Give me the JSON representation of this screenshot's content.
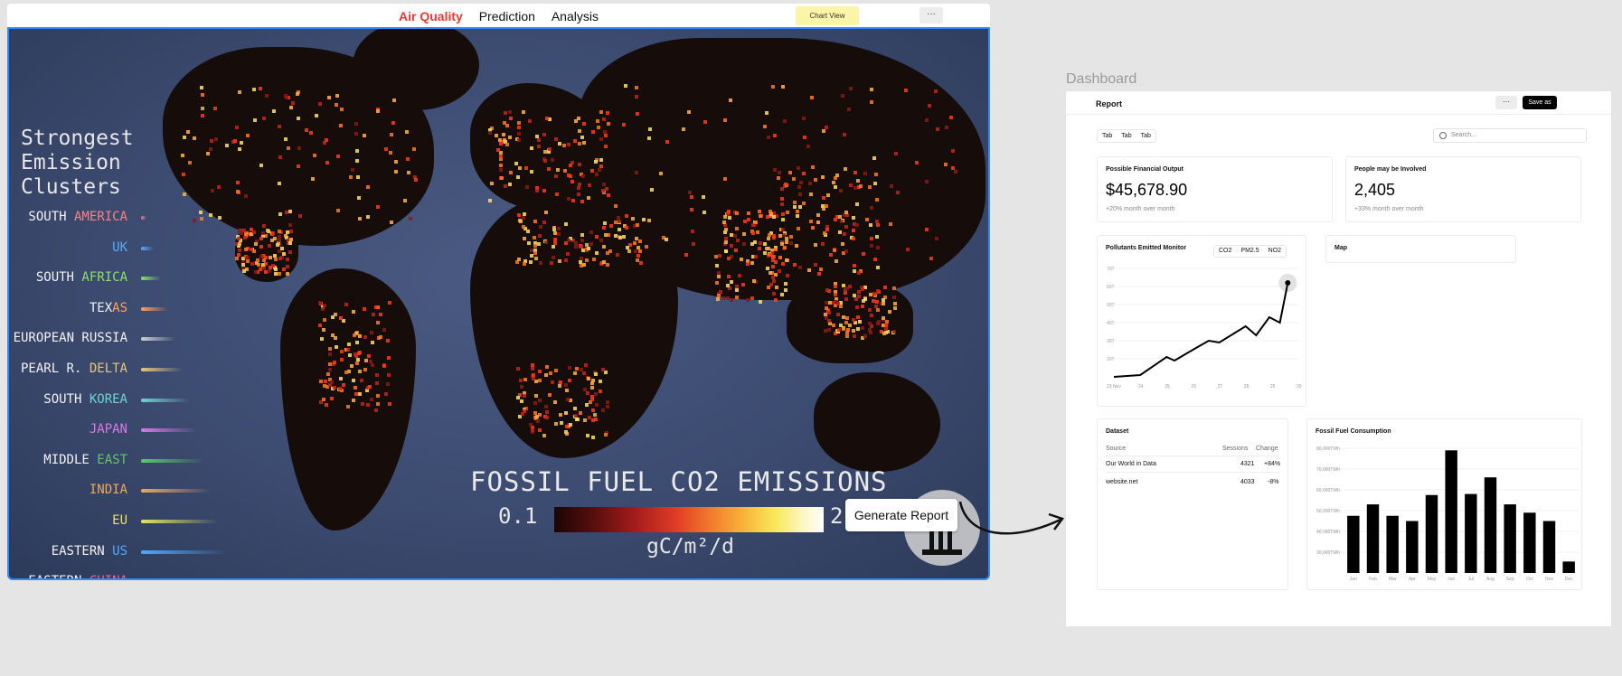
{
  "nav": {
    "items": [
      {
        "label": "Air Quality",
        "active": true
      },
      {
        "label": "Prediction",
        "active": false
      },
      {
        "label": "Analysis",
        "active": false
      }
    ],
    "chart_view_label": "Chart View",
    "more_label": "···"
  },
  "map": {
    "legend_title": "Strongest\nEmission\nClusters",
    "clusters": [
      {
        "pre": "SOUTH ",
        "hl": "AMERICA",
        "color": "#ff8080"
      },
      {
        "pre": "",
        "hl": "UK",
        "color": "#5aa9ff"
      },
      {
        "pre": "SOUTH ",
        "hl": "AFRICA",
        "color": "#8ee06a"
      },
      {
        "pre": "TEX",
        "hl": "AS",
        "color": "#ff9f5a"
      },
      {
        "pre": "EUROPEAN RUSSIA",
        "hl": "",
        "color": "#d0d0d0"
      },
      {
        "pre": "PEARL R. ",
        "hl": "DELTA",
        "color": "#e6c77a"
      },
      {
        "pre": "SOUTH ",
        "hl": "KOREA",
        "color": "#6fd3d3"
      },
      {
        "pre": "",
        "hl": "JAPAN",
        "color": "#d67ae6"
      },
      {
        "pre": "MIDDLE ",
        "hl": "EAST",
        "color": "#5fc96a"
      },
      {
        "pre": "",
        "hl": "INDIA",
        "color": "#f0a85a"
      },
      {
        "pre": "",
        "hl": "EU",
        "color": "#e8e35a"
      },
      {
        "pre": "EASTERN ",
        "hl": "US",
        "color": "#4fa8ff"
      },
      {
        "pre": "EASTERN ",
        "hl": "CHINA",
        "color": "#ff5a8c"
      }
    ],
    "title": "FOSSIL FUEL CO2 EMISSIONS",
    "scale_min": "0.1",
    "scale_max": "2",
    "unit": "gC/m²/d",
    "generate_label": "Generate Report"
  },
  "dashboard": {
    "label": "Dashboard",
    "title": "Report",
    "more_label": "···",
    "save_label": "Save as",
    "tabs": [
      "Tab",
      "Tab",
      "Tab"
    ],
    "search_placeholder": "Search...",
    "kpi": [
      {
        "title": "Possible Financial Output",
        "value": "$45,678.90",
        "sub": "+20% month over month"
      },
      {
        "title": "People may be Involved",
        "value": "2,405",
        "sub": "+33% month over month"
      }
    ],
    "pollutant": {
      "title": "Pollutants Emitted Monitor",
      "tabs": [
        "CO2",
        "PM2.5",
        "NO2"
      ]
    },
    "map_card_title": "Map",
    "dataset": {
      "title": "Dataset",
      "headers": [
        "Source",
        "Sessions",
        "Change"
      ],
      "rows": [
        [
          "Our World in Data",
          "4321",
          "+84%"
        ],
        [
          "website.net",
          "4033",
          "-8%"
        ]
      ]
    },
    "fossil_title": "Fossil Fuel Consumption"
  },
  "chart_data": [
    {
      "type": "line",
      "title": "Pollutants Emitted Monitor",
      "x": [
        "23 Nov",
        "24",
        "25",
        "26",
        "27",
        "28",
        "29",
        "30"
      ],
      "y_ticks": [
        "20T",
        "30T",
        "40T",
        "50T",
        "60T",
        "70T"
      ],
      "ylim": [
        10,
        70
      ],
      "xlim": [
        0,
        7
      ],
      "points": [
        [
          0,
          10
        ],
        [
          1,
          11
        ],
        [
          2,
          21
        ],
        [
          2.3,
          19
        ],
        [
          3,
          25
        ],
        [
          3.6,
          30
        ],
        [
          4,
          29
        ],
        [
          5,
          38
        ],
        [
          5.4,
          33
        ],
        [
          5.9,
          43
        ],
        [
          6.3,
          40
        ],
        [
          6.6,
          62
        ]
      ],
      "highlight_index": 11
    },
    {
      "type": "bar",
      "title": "Fossil Fuel Consumption",
      "categories": [
        "Jan",
        "Feb",
        "Mar",
        "Apr",
        "May",
        "Jun",
        "Jul",
        "Aug",
        "Sep",
        "Oct",
        "Nov",
        "Dec"
      ],
      "values": [
        47500,
        53000,
        47500,
        45000,
        57500,
        79000,
        58000,
        66000,
        53000,
        49000,
        45000,
        25500
      ],
      "y_ticks": [
        "30,000TWh",
        "40,000TWh",
        "50,000TWh",
        "60,000TWh",
        "70,000TWh",
        "80,000TWh"
      ],
      "ylim": [
        20000,
        80000
      ]
    }
  ]
}
